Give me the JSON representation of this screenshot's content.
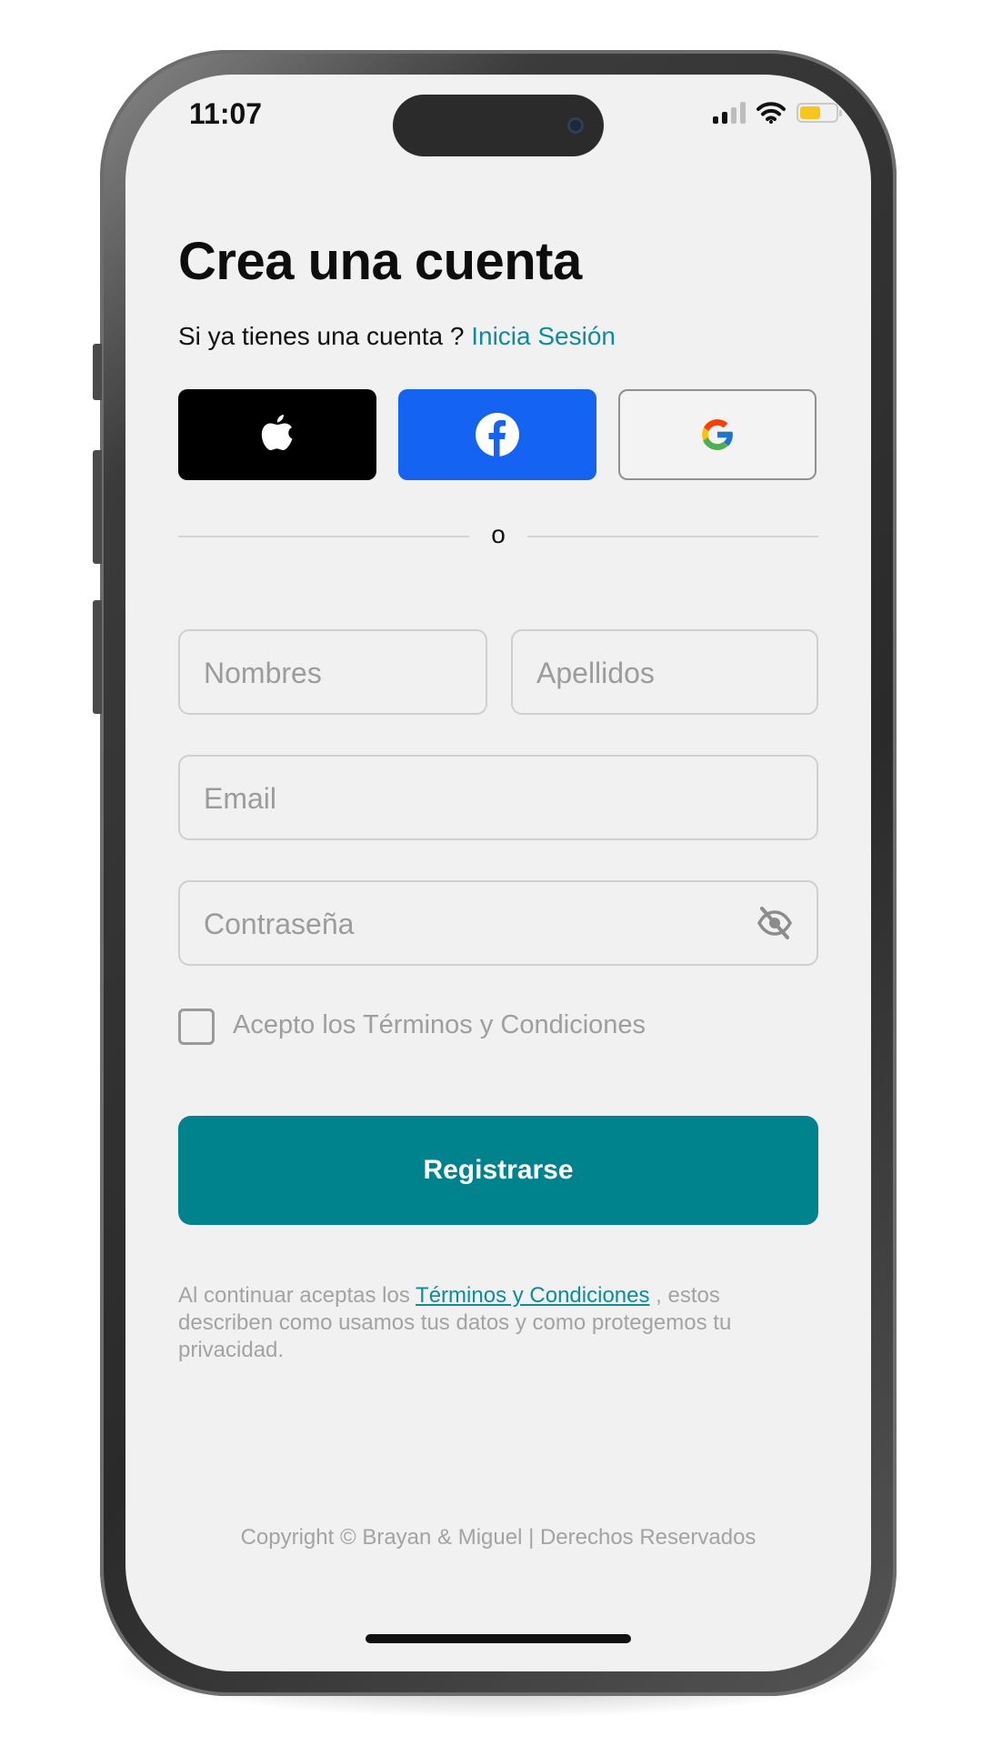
{
  "status_bar": {
    "time": "11:07"
  },
  "header": {
    "title": "Crea una cuenta",
    "subtitle_prefix": "Si ya tienes una cuenta ? ",
    "login_link": "Inicia Sesión"
  },
  "social": [
    {
      "name": "apple",
      "icon": "apple-logo-icon",
      "color": "#000000"
    },
    {
      "name": "facebook",
      "icon": "facebook-logo-icon",
      "color": "#1463F3"
    },
    {
      "name": "google",
      "icon": "google-logo-icon",
      "color": "#F3F3F3"
    }
  ],
  "divider": {
    "text": "o"
  },
  "form": {
    "first_name_placeholder": "Nombres",
    "last_name_placeholder": "Apellidos",
    "email_placeholder": "Email",
    "password_placeholder": "Contraseña",
    "password_toggle_icon": "eye-off-icon",
    "terms_checkbox_label": "Acepto los Términos y Condiciones",
    "terms_checked": false
  },
  "submit": {
    "label": "Registrarse",
    "color": "#01838E"
  },
  "legal": {
    "prefix": "Al continuar aceptas los ",
    "link": "Términos y Condiciones",
    "suffix": " , estos describen como usamos tus datos y como protegemos tu privacidad."
  },
  "footer": {
    "copyright": "Copyright © Brayan & Miguel | Derechos Reservados"
  },
  "colors": {
    "accent": "#0A8F98",
    "background": "#F1F1F1"
  }
}
